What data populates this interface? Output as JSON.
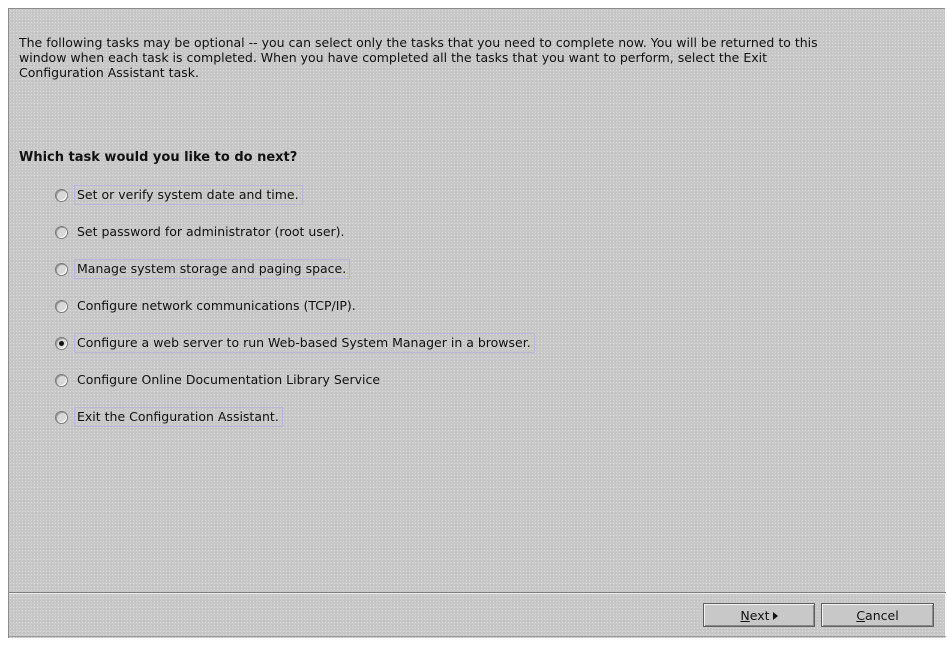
{
  "intro_text": "The following tasks may be optional -- you can select only the tasks that you need to complete now. You will be returned to this window when each task is completed.  When you have completed all the tasks that you want to perform, select the Exit Configuration Assistant task.",
  "question": "Which task would you like to do next?",
  "options": [
    {
      "label": "Set or verify system date and time.",
      "selected": false
    },
    {
      "label": "Set password for administrator (root user).",
      "selected": false
    },
    {
      "label": "Manage system storage and paging space.",
      "selected": false
    },
    {
      "label": "Configure network communications (TCP/IP).",
      "selected": false
    },
    {
      "label": "Configure a web server to run Web-based System Manager in a browser.",
      "selected": true
    },
    {
      "label": "Configure Online Documentation Library Service",
      "selected": false
    },
    {
      "label": "Exit the Configuration Assistant.",
      "selected": false
    }
  ],
  "buttons": {
    "next_mnemonic": "N",
    "next_rest": "ext",
    "next_icon": "arrow-right-icon",
    "cancel_mnemonic": "C",
    "cancel_rest": "ancel"
  }
}
